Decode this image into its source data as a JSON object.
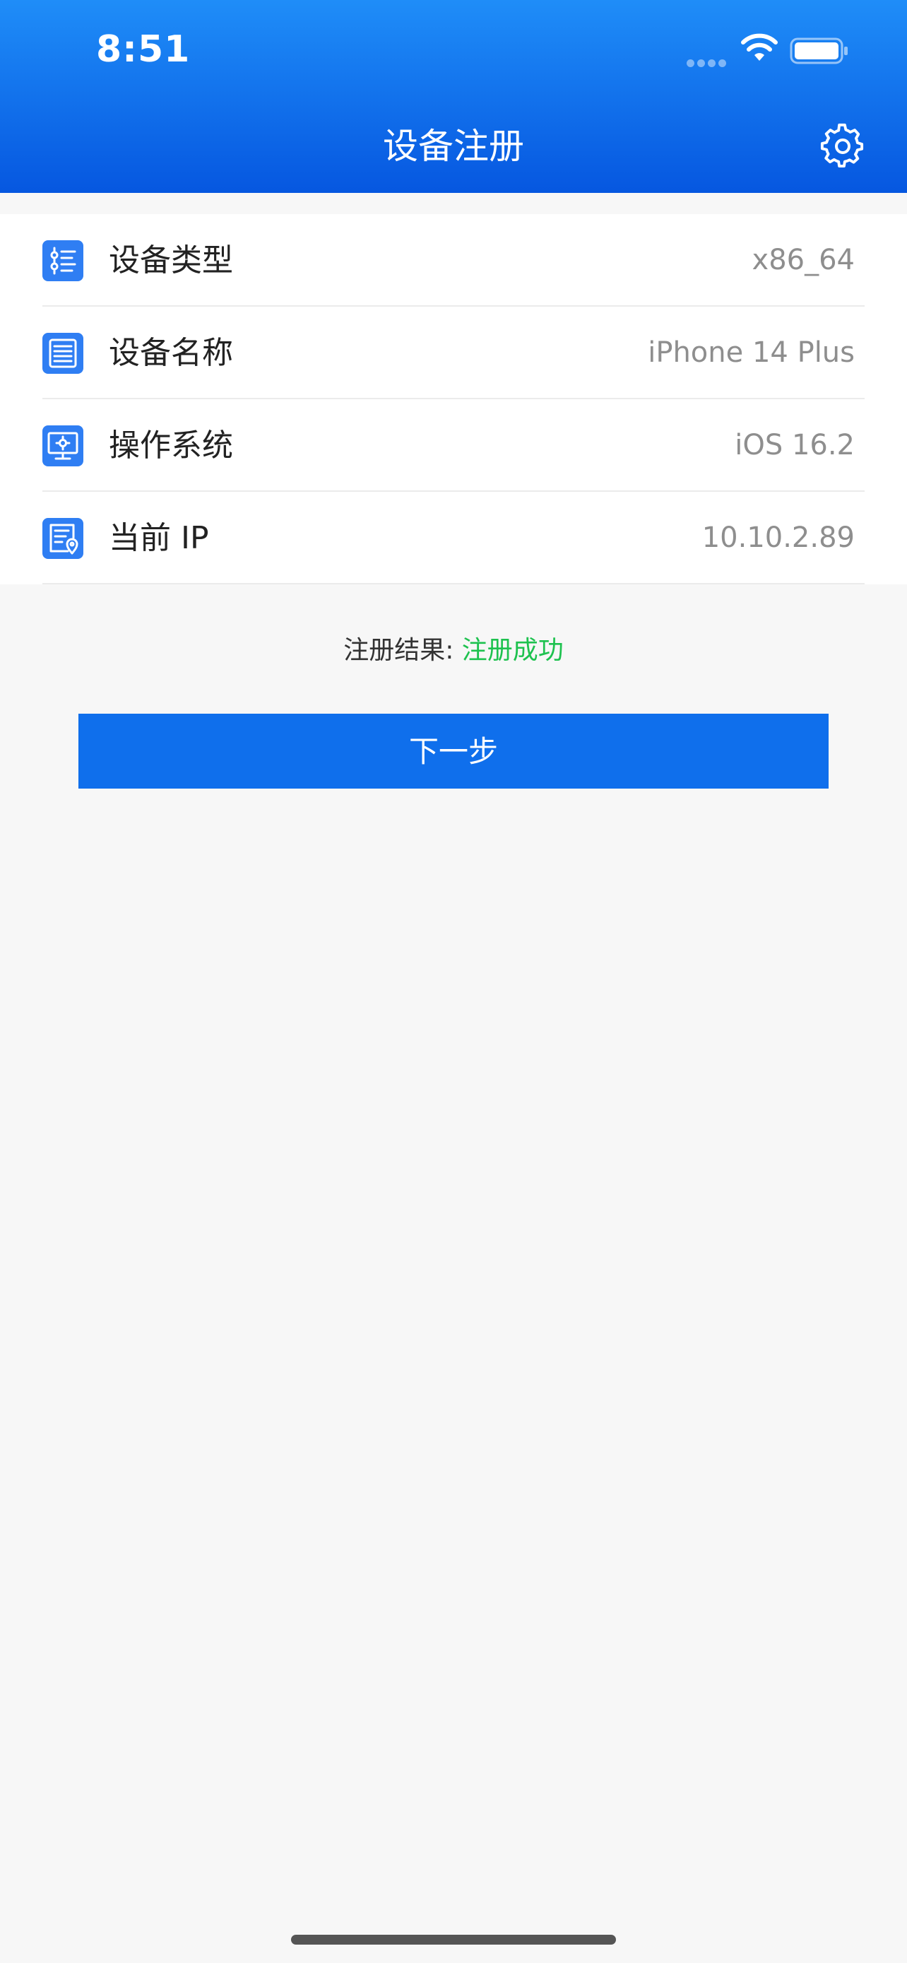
{
  "status_bar": {
    "time": "8:51"
  },
  "header": {
    "title": "设备注册"
  },
  "device_info": [
    {
      "label": "设备类型",
      "value": "x86_64",
      "icon": "list-settings-icon"
    },
    {
      "label": "设备名称",
      "value": "iPhone 14 Plus",
      "icon": "server-list-icon"
    },
    {
      "label": "操作系统",
      "value": "iOS 16.2",
      "icon": "monitor-gear-icon"
    },
    {
      "label": "当前 IP",
      "value": "10.10.2.89",
      "icon": "document-location-icon"
    }
  ],
  "result": {
    "label": "注册结果: ",
    "status": "注册成功"
  },
  "actions": {
    "next_label": "下一步"
  },
  "colors": {
    "header_top": "#1f8df8",
    "header_bottom": "#0657e0",
    "icon_bg": "#2f7ef3",
    "success": "#1ec24f",
    "button": "#0f6fec",
    "background": "#f7f7f7"
  }
}
